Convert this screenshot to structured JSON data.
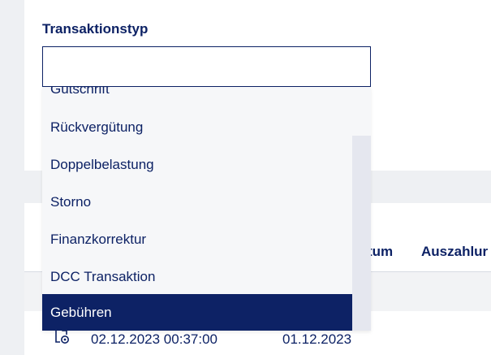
{
  "filter": {
    "label": "Transaktionstyp",
    "value": "",
    "options": [
      {
        "label": "Gutschrift"
      },
      {
        "label": "Rückvergütung"
      },
      {
        "label": "Doppelbelastung"
      },
      {
        "label": "Storno"
      },
      {
        "label": "Finanzkorrektur"
      },
      {
        "label": "DCC Transaktion"
      },
      {
        "label": "Gebühren",
        "selected": true
      }
    ]
  },
  "table": {
    "headers": {
      "datum_partial": "tum",
      "payout_partial": "Auszahlur"
    },
    "rows": [
      {
        "icon": "document-view-icon",
        "datetime": "02.12.2023 00:37:00",
        "date": "01.12.2023"
      }
    ]
  },
  "colors": {
    "primary": "#0d2265",
    "background": "#eef0f3",
    "dropdown_bg": "#f6f7f9",
    "selected_bg": "#0d2265"
  }
}
